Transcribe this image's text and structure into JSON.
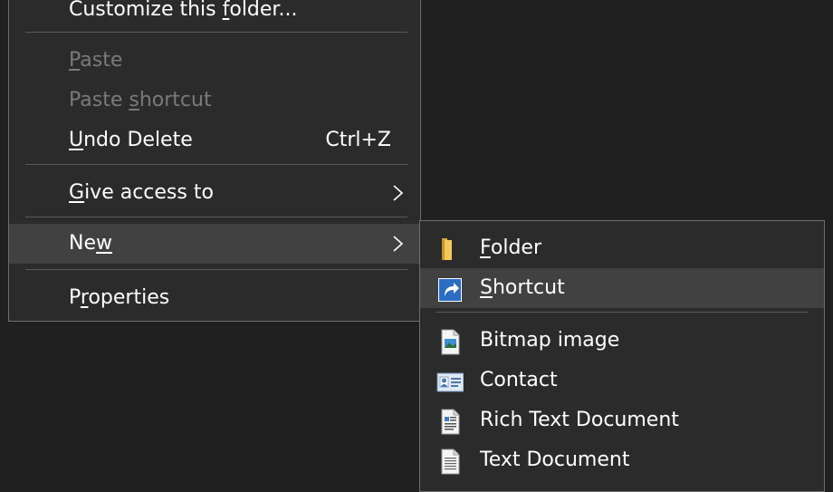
{
  "context_menu": {
    "items": [
      {
        "id": "customize",
        "pre": "Customize this ",
        "acc": "f",
        "post": "older..."
      },
      {
        "id": "paste",
        "pre": "",
        "acc": "P",
        "post": "aste"
      },
      {
        "id": "paste-shortcut",
        "pre": "Paste ",
        "acc": "s",
        "post": "hortcut"
      },
      {
        "id": "undo-delete",
        "pre": "",
        "acc": "U",
        "post": "ndo Delete",
        "shortcut": "Ctrl+Z"
      },
      {
        "id": "give-access",
        "pre": "",
        "acc": "G",
        "post": "ive access to"
      },
      {
        "id": "new",
        "pre": "Ne",
        "acc": "w",
        "post": ""
      },
      {
        "id": "properties",
        "pre": "P",
        "acc": "r",
        "post": "operties"
      }
    ]
  },
  "new_submenu": {
    "items": [
      {
        "id": "folder",
        "pre": "",
        "acc": "F",
        "post": "older",
        "icon": "folder-icon"
      },
      {
        "id": "shortcut",
        "pre": "",
        "acc": "S",
        "post": "hortcut",
        "icon": "shortcut-icon"
      },
      {
        "id": "bitmap",
        "pre": "Bitmap image",
        "acc": "",
        "post": "",
        "icon": "bitmap-icon"
      },
      {
        "id": "contact",
        "pre": "Contact",
        "acc": "",
        "post": "",
        "icon": "contact-icon"
      },
      {
        "id": "rtf",
        "pre": "Rich Text Document",
        "acc": "",
        "post": "",
        "icon": "rich-text-document-icon"
      },
      {
        "id": "txt",
        "pre": "Text Document",
        "acc": "",
        "post": "",
        "icon": "text-document-icon"
      }
    ]
  },
  "colors": {
    "menu_bg": "#2b2b2b",
    "highlight": "#414141",
    "disabled_text": "#7a7a7a",
    "border": "#6e6e6e",
    "desktop_bg": "#202020"
  }
}
